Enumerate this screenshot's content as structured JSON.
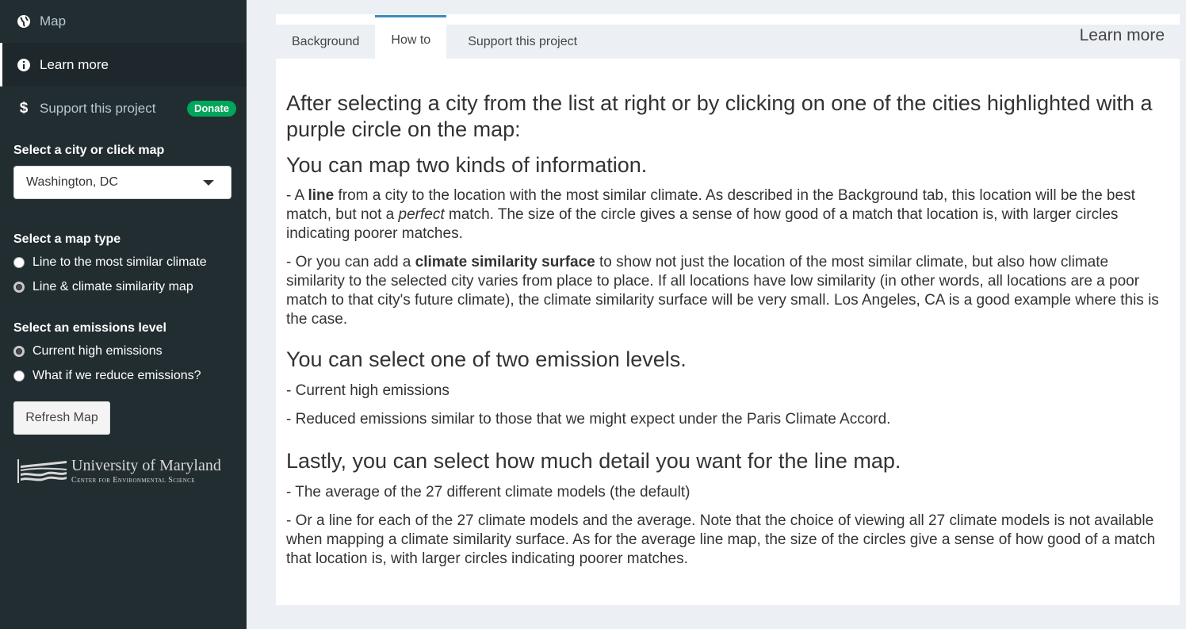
{
  "sidebar": {
    "menu": [
      {
        "label": "Map",
        "icon": "globe-icon"
      },
      {
        "label": "Learn more",
        "icon": "info-icon"
      },
      {
        "label": "Support this project",
        "icon": "dollar-icon",
        "badge": "Donate"
      }
    ],
    "city": {
      "label": "Select a city or click map",
      "value": "Washington, DC"
    },
    "map_type": {
      "label": "Select a map type",
      "options": [
        "Line to the most similar climate",
        "Line & climate similarity map"
      ],
      "selected": 1
    },
    "emissions": {
      "label": "Select an emissions level",
      "options": [
        "Current high emissions",
        "What if we reduce emissions?"
      ],
      "selected": 0
    },
    "refresh_label": "Refresh Map",
    "logo": {
      "line1": "University of Maryland",
      "line2": "Center for Environmental Science"
    }
  },
  "tabs": {
    "items": [
      "Background",
      "How to",
      "Support this project"
    ],
    "active": 1,
    "title": "Learn more"
  },
  "content": {
    "intro": "After selecting a city from the list at right or by clicking on one of the cities highlighted with a purple circle on the map:",
    "h_kinds": "You can map two kinds of information.",
    "p_line_pre": "- A ",
    "p_line_bold": "line",
    "p_line_mid": " from a city to the location with the most similar climate. As described in the Background tab, this location will be the best match, but not a ",
    "p_line_italic": "perfect",
    "p_line_post": " match. The size of the circle gives a sense of how good of a match that location is, with larger circles indicating poorer matches.",
    "p_surface_pre": "- Or you can add a ",
    "p_surface_bold": "climate similarity surface",
    "p_surface_post": " to show not just the location of the most similar climate, but also how climate similarity to the selected city varies from place to place. If all locations have low similarity (in other words, all locations are a poor match to that city's future climate), the climate similarity surface will be very small. Los Angeles, CA is a good example where this is the case.",
    "h_emissions": "You can select one of two emission levels.",
    "p_em1": "- Current high emissions",
    "p_em2": "- Reduced emissions similar to those that we might expect under the Paris Climate Accord.",
    "h_detail": "Lastly, you can select how much detail you want for the line map.",
    "p_d1": "- The average of the 27 different climate models (the default)",
    "p_d2": "- Or a line for each of the 27 climate models and the average. Note that the choice of viewing all 27 climate models is not available when mapping a climate similarity surface. As for the average line map, the size of the circles give a sense of how good of a match that location is, with larger circles indicating poorer matches."
  },
  "colors": {
    "sidebar": "#222d32",
    "active_tab_border": "#3c8dbc",
    "badge": "#00a65a",
    "background": "#ecf0f5"
  }
}
